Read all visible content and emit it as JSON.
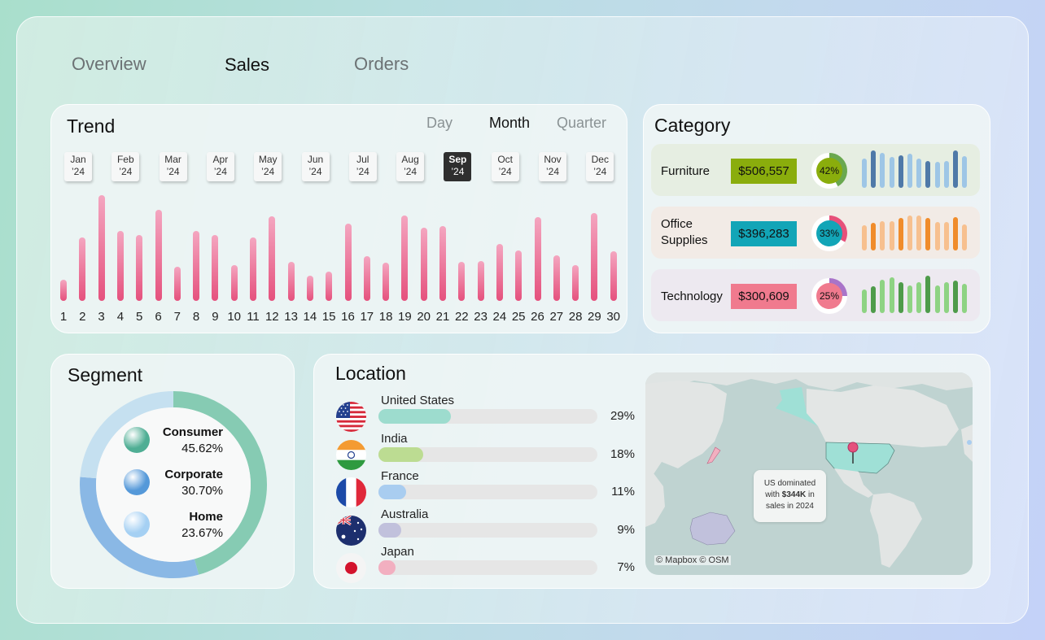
{
  "nav": {
    "tabs": [
      "Overview",
      "Sales",
      "Orders"
    ],
    "active": "Sales"
  },
  "trend": {
    "title": "Trend",
    "granularity": [
      "Day",
      "Month",
      "Quarter"
    ],
    "active_granularity": "Month",
    "months": [
      {
        "m": "Jan",
        "y": "’24"
      },
      {
        "m": "Feb",
        "y": "’24"
      },
      {
        "m": "Mar",
        "y": "’24"
      },
      {
        "m": "Apr",
        "y": "’24"
      },
      {
        "m": "May",
        "y": "’24"
      },
      {
        "m": "Jun",
        "y": "’24"
      },
      {
        "m": "Jul",
        "y": "’24"
      },
      {
        "m": "Aug",
        "y": "’24"
      },
      {
        "m": "Sep",
        "y": "’24"
      },
      {
        "m": "Oct",
        "y": "’24"
      },
      {
        "m": "Nov",
        "y": "’24"
      },
      {
        "m": "Dec",
        "y": "’24"
      }
    ],
    "active_month": "Sep"
  },
  "chart_data": {
    "type": "bar",
    "categories": [
      "1",
      "2",
      "3",
      "4",
      "5",
      "6",
      "7",
      "8",
      "9",
      "10",
      "11",
      "12",
      "13",
      "14",
      "15",
      "16",
      "17",
      "18",
      "19",
      "20",
      "21",
      "22",
      "23",
      "24",
      "25",
      "26",
      "27",
      "28",
      "29",
      "30"
    ],
    "values": [
      20,
      60,
      100,
      66,
      62,
      86,
      32,
      66,
      62,
      34,
      60,
      80,
      37,
      24,
      28,
      73,
      42,
      36,
      81,
      69,
      71,
      37,
      38,
      54,
      48,
      79,
      43,
      34,
      83,
      47
    ],
    "ylim": [
      0,
      100
    ],
    "color_top": "#f4a6c0",
    "color_bottom": "#e5517d"
  },
  "category": {
    "title": "Category",
    "rows": [
      {
        "name": "Furniture",
        "value": "$506,557",
        "pct_label": "42%",
        "pct": 0.42,
        "row_bg": "#e6eee2",
        "value_bg": "#8aad0c",
        "ring": "#6aa84f",
        "center": "#8aad0c",
        "bars": [
          0.78,
          1.0,
          0.93,
          0.82,
          0.87,
          0.91,
          0.78,
          0.72,
          0.69,
          0.72,
          1.0,
          0.85
        ],
        "bar_colors": [
          "#9ec6e6",
          "#4f79a8"
        ]
      },
      {
        "name": "Office Supplies",
        "value": "$396,283",
        "pct_label": "33%",
        "pct": 0.33,
        "row_bg": "#f2ebe6",
        "value_bg": "#12a5b7",
        "ring": "#e6507a",
        "center": "#12a5b7",
        "bars": [
          0.68,
          0.75,
          0.79,
          0.79,
          0.87,
          0.93,
          0.93,
          0.87,
          0.77,
          0.77,
          0.9,
          0.7
        ],
        "bar_colors": [
          "#f7c08f",
          "#f08c2b"
        ]
      },
      {
        "name": "Technology",
        "value": "$300,609",
        "pct_label": "25%",
        "pct": 0.25,
        "row_bg": "#ede9f0",
        "value_bg": "#f07a8e",
        "ring": "#a974c9",
        "center": "#f07a8e",
        "bars": [
          0.62,
          0.71,
          0.89,
          0.96,
          0.82,
          0.75,
          0.82,
          1.0,
          0.75,
          0.82,
          0.86,
          0.78
        ],
        "bar_colors": [
          "#8ed383",
          "#4e9b4a"
        ]
      }
    ]
  },
  "segment": {
    "title": "Segment",
    "items": [
      {
        "name": "Consumer",
        "pct_label": "45.62%",
        "pct": 0.4562,
        "color": "#86cbb3",
        "dot": "#4fae94"
      },
      {
        "name": "Corporate",
        "pct_label": "30.70%",
        "pct": 0.307,
        "color": "#8ab8e5",
        "dot": "#5599d9"
      },
      {
        "name": "Home",
        "pct_label": "23.67%",
        "pct": 0.2367,
        "color": "#c5e0f0",
        "dot": "#a5d0f3"
      }
    ]
  },
  "location": {
    "title": "Location",
    "items": [
      {
        "country": "United States",
        "pct_label": "29%",
        "pct": 0.29,
        "color": "#9ddcce",
        "flag": "us-flag-icon"
      },
      {
        "country": "India",
        "pct_label": "18%",
        "pct": 0.18,
        "color": "#bcdc92",
        "flag": "india-flag-icon"
      },
      {
        "country": "France",
        "pct_label": "11%",
        "pct": 0.11,
        "color": "#a9cdf0",
        "flag": "france-flag-icon"
      },
      {
        "country": "Australia",
        "pct_label": "9%",
        "pct": 0.09,
        "color": "#c1c1dc",
        "flag": "australia-flag-icon"
      },
      {
        "country": "Japan",
        "pct_label": "7%",
        "pct": 0.07,
        "color": "#f2afc0",
        "flag": "japan-flag-icon"
      }
    ],
    "map": {
      "tooltip_line1": "US dominated",
      "tooltip_line2a": "with ",
      "tooltip_value": "$344K",
      "tooltip_line2b": " in",
      "tooltip_line3": "sales in 2024",
      "credit": "© Mapbox © OSM"
    }
  }
}
